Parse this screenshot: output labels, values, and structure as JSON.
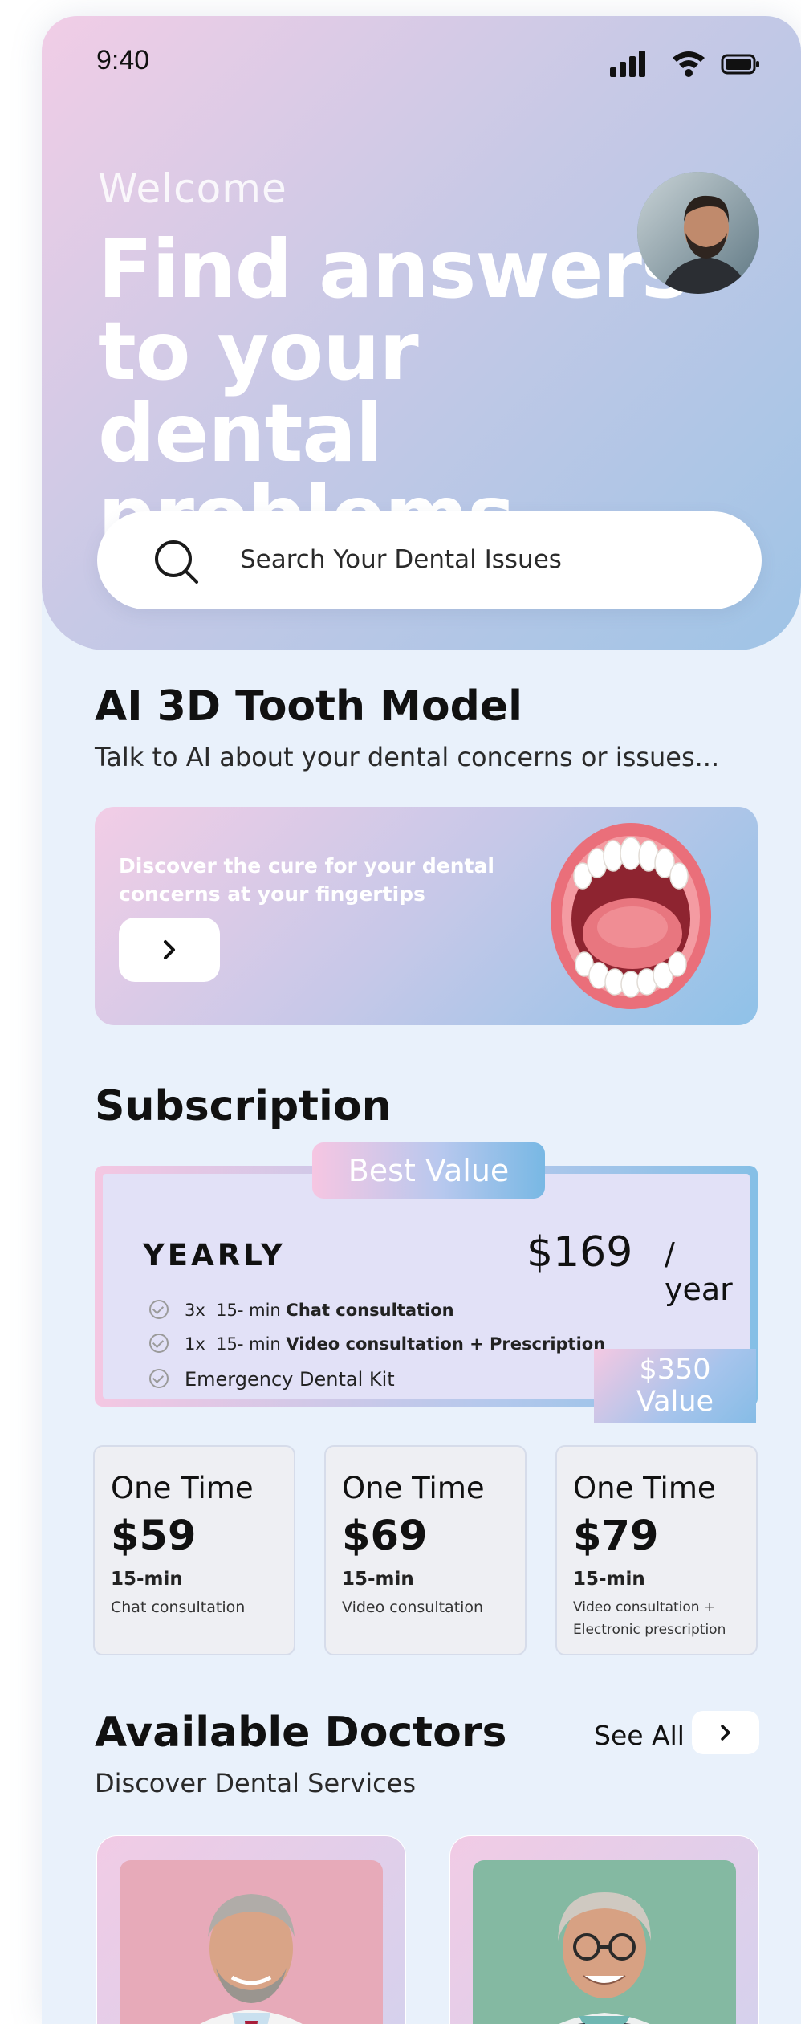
{
  "status_bar": {
    "time": "9:40"
  },
  "header": {
    "welcome": "Welcome",
    "headline": "Find answers to your dental problems"
  },
  "search": {
    "placeholder": "Search Your Dental Issues"
  },
  "ai_model": {
    "title": "AI 3D Tooth Model",
    "subtitle": "Talk to AI about your dental concerns or issues...",
    "card_text": "Discover the cure for your dental concerns at your fingertips"
  },
  "subscription": {
    "title": "Subscription",
    "badge": "Best Value",
    "plan": "YEARLY",
    "price": "$169",
    "period": "/ year",
    "features": [
      {
        "qty": "3x",
        "duration": "15- min",
        "label": "Chat consultation"
      },
      {
        "qty": "1x",
        "duration": "15- min",
        "label": "Video consultation + Prescription"
      },
      {
        "qty": "",
        "duration": "",
        "label": "Emergency Dental Kit"
      }
    ],
    "value_amount": "$350",
    "value_label": "Value"
  },
  "one_time": [
    {
      "title": "One Time",
      "price": "$59",
      "duration": "15-min",
      "desc": "Chat  consultation"
    },
    {
      "title": "One Time",
      "price": "$69",
      "duration": "15-min",
      "desc": "Video  consultation"
    },
    {
      "title": "One Time",
      "price": "$79",
      "duration": "15-min",
      "desc": "Video consultation + Electronic prescription"
    }
  ],
  "doctors": {
    "title": "Available Doctors",
    "subtitle": "Discover Dental Services",
    "see_all": "See All"
  },
  "colors": {
    "hero_gradient": [
      "#f1cde6",
      "#c8c9e6",
      "#9fc4e6"
    ],
    "background": "#e9f1fb",
    "subscription_inner": "#e2e1f7"
  }
}
